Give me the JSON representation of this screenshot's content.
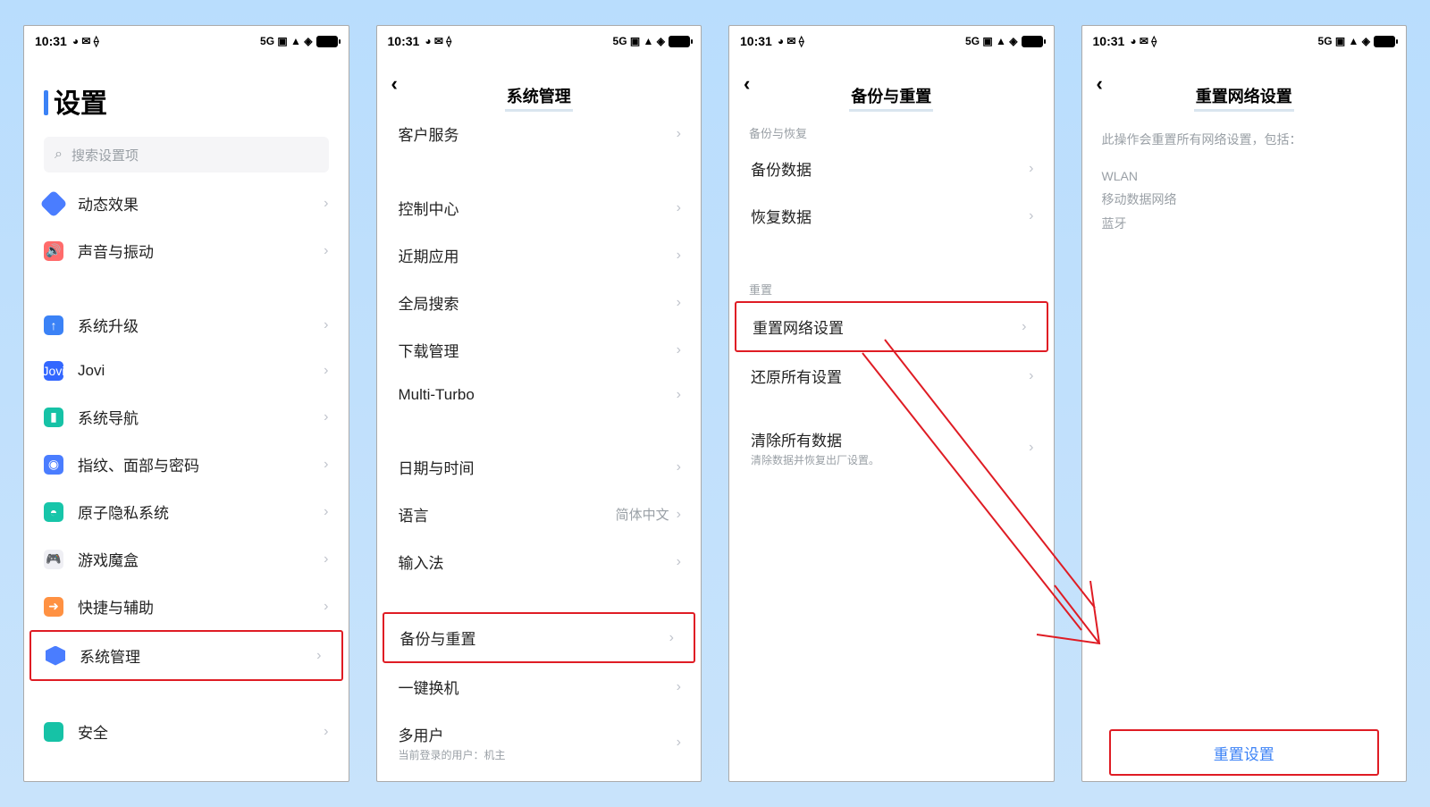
{
  "status": {
    "time": "10:31",
    "left_icons": "◕ ✉ ⟠",
    "right_text": "5G ▣ ▲ ◈"
  },
  "screen1": {
    "title": "设置",
    "search_placeholder": "搜索设置项",
    "items1": [
      {
        "k": "dynamic",
        "label": "动态效果"
      },
      {
        "k": "sound",
        "label": "声音与振动"
      }
    ],
    "items2": [
      {
        "k": "upgrade",
        "label": "系统升级"
      },
      {
        "k": "jovi",
        "label": "Jovi"
      },
      {
        "k": "nav",
        "label": "系统导航"
      },
      {
        "k": "finger",
        "label": "指纹、面部与密码"
      },
      {
        "k": "privacy",
        "label": "原子隐私系统"
      },
      {
        "k": "gamebox",
        "label": "游戏魔盒"
      },
      {
        "k": "shortcut",
        "label": "快捷与辅助"
      },
      {
        "k": "sysmgmt",
        "label": "系统管理"
      }
    ],
    "items3": [
      {
        "k": "security",
        "label": "安全"
      }
    ]
  },
  "screen2": {
    "title": "系统管理",
    "g1": [
      {
        "k": "cust",
        "label": "客户服务"
      }
    ],
    "g2": [
      {
        "k": "ctrl",
        "label": "控制中心"
      },
      {
        "k": "recent",
        "label": "近期应用"
      },
      {
        "k": "gsearch",
        "label": "全局搜索"
      },
      {
        "k": "dlmgr",
        "label": "下载管理"
      },
      {
        "k": "multiturbo",
        "label": "Multi-Turbo"
      }
    ],
    "g3": [
      {
        "k": "datetime",
        "label": "日期与时间"
      },
      {
        "k": "lang",
        "label": "语言",
        "value": "简体中文"
      },
      {
        "k": "ime",
        "label": "输入法"
      }
    ],
    "g4": [
      {
        "k": "backup",
        "label": "备份与重置"
      },
      {
        "k": "clone",
        "label": "一键换机"
      },
      {
        "k": "multiuser",
        "label": "多用户",
        "sub": "当前登录的用户：机主"
      }
    ]
  },
  "screen3": {
    "title": "备份与重置",
    "sec1_label": "备份与恢复",
    "sec1": [
      {
        "k": "backupdata",
        "label": "备份数据"
      },
      {
        "k": "restoredata",
        "label": "恢复数据"
      }
    ],
    "sec2_label": "重置",
    "sec2": [
      {
        "k": "resetnet",
        "label": "重置网络设置"
      },
      {
        "k": "resetall",
        "label": "还原所有设置"
      }
    ],
    "sec3": [
      {
        "k": "erase",
        "label": "清除所有数据",
        "sub": "清除数据并恢复出厂设置。"
      }
    ]
  },
  "screen4": {
    "title": "重置网络设置",
    "lead": "此操作会重置所有网络设置，包括：",
    "lines": [
      "WLAN",
      "移动数据网络",
      "蓝牙"
    ],
    "action": "重置设置"
  }
}
